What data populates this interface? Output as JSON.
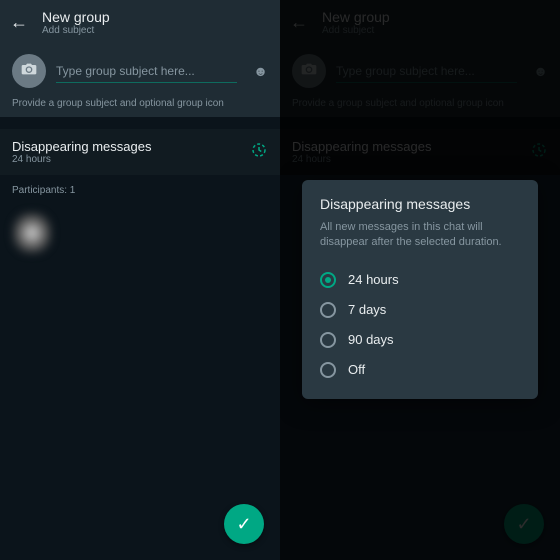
{
  "header": {
    "title": "New group",
    "subtitle": "Add subject"
  },
  "subject": {
    "placeholder": "Type group subject here...",
    "hint": "Provide a group subject and optional group icon"
  },
  "dm": {
    "title": "Disappearing messages",
    "value": "24 hours"
  },
  "participants": {
    "label": "Participants: 1"
  },
  "dialog": {
    "title": "Disappearing messages",
    "desc": "All new messages in this chat will disappear after the selected duration.",
    "options": {
      "o0": "24 hours",
      "o1": "7 days",
      "o2": "90 days",
      "o3": "Off"
    },
    "selected": 0
  },
  "colors": {
    "accent": "#00a884"
  }
}
